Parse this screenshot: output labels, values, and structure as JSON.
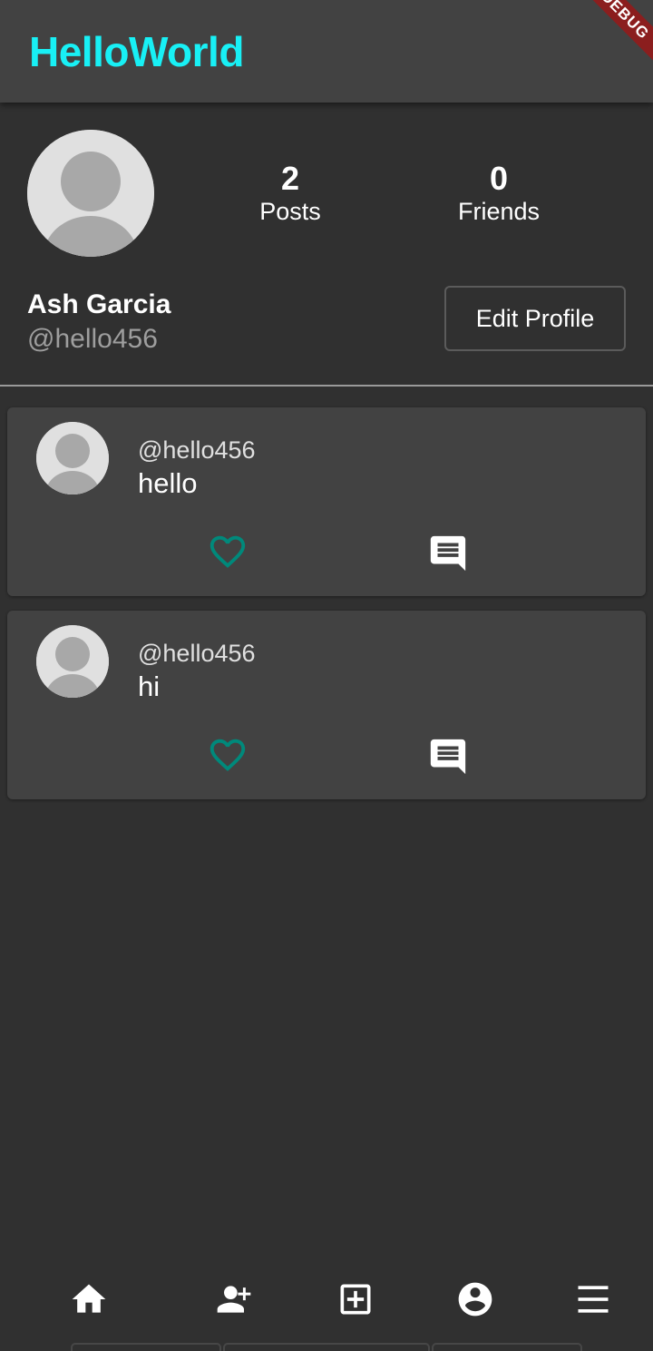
{
  "app": {
    "title": "HelloWorld",
    "debug_banner": "DEBUG",
    "accent_color": "#18f0f5",
    "like_color": "#00897b"
  },
  "profile": {
    "name": "Ash Garcia",
    "handle": "@hello456",
    "posts_count": "2",
    "posts_label": "Posts",
    "friends_count": "0",
    "friends_label": "Friends",
    "edit_button_label": "Edit Profile"
  },
  "posts": [
    {
      "handle": "@hello456",
      "text": "hello",
      "liked": false
    },
    {
      "handle": "@hello456",
      "text": "hi",
      "liked": false
    }
  ],
  "bottom_nav": {
    "items": [
      {
        "icon": "home-icon"
      },
      {
        "icon": "person-add-icon"
      },
      {
        "icon": "add-box-icon"
      },
      {
        "icon": "account-circle-icon"
      },
      {
        "icon": "menu-icon"
      }
    ]
  }
}
